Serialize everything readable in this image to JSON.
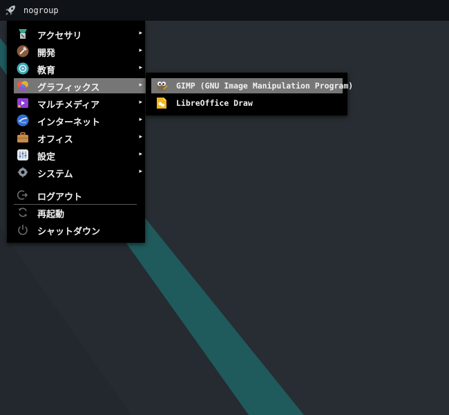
{
  "topbar": {
    "title": "nogroup",
    "launcher_icon": "rocket-icon"
  },
  "menu": {
    "items": [
      {
        "label": "アクセサリ",
        "icon": "accessories-icon",
        "has_submenu": true
      },
      {
        "label": "開発",
        "icon": "development-icon",
        "has_submenu": true
      },
      {
        "label": "教育",
        "icon": "education-icon",
        "has_submenu": true
      },
      {
        "label": "グラフィックス",
        "icon": "graphics-icon",
        "has_submenu": true,
        "selected": true
      },
      {
        "label": "マルチメディア",
        "icon": "multimedia-icon",
        "has_submenu": true
      },
      {
        "label": "インターネット",
        "icon": "internet-icon",
        "has_submenu": true
      },
      {
        "label": "オフィス",
        "icon": "office-icon",
        "has_submenu": true
      },
      {
        "label": "設定",
        "icon": "settings-icon",
        "has_submenu": true
      },
      {
        "label": "システム",
        "icon": "system-icon",
        "has_submenu": true
      }
    ],
    "actions": [
      {
        "label": "ログアウト",
        "icon": "logout-icon"
      },
      {
        "label": "再起動",
        "icon": "restart-icon"
      },
      {
        "label": "シャットダウン",
        "icon": "shutdown-icon"
      }
    ],
    "arrow": "▸"
  },
  "submenu": {
    "items": [
      {
        "label": "GIMP (GNU Image Manipulation Program)",
        "icon": "gimp-icon",
        "selected": true
      },
      {
        "label": "LibreOffice Draw",
        "icon": "libreoffice-draw-icon"
      }
    ]
  },
  "colors": {
    "desktop": "#252b30",
    "diagonal_band": "#1f5a5d",
    "menu_bg": "#000000",
    "selected_bg": "#767676",
    "topbar_bg": "#0f1216"
  }
}
